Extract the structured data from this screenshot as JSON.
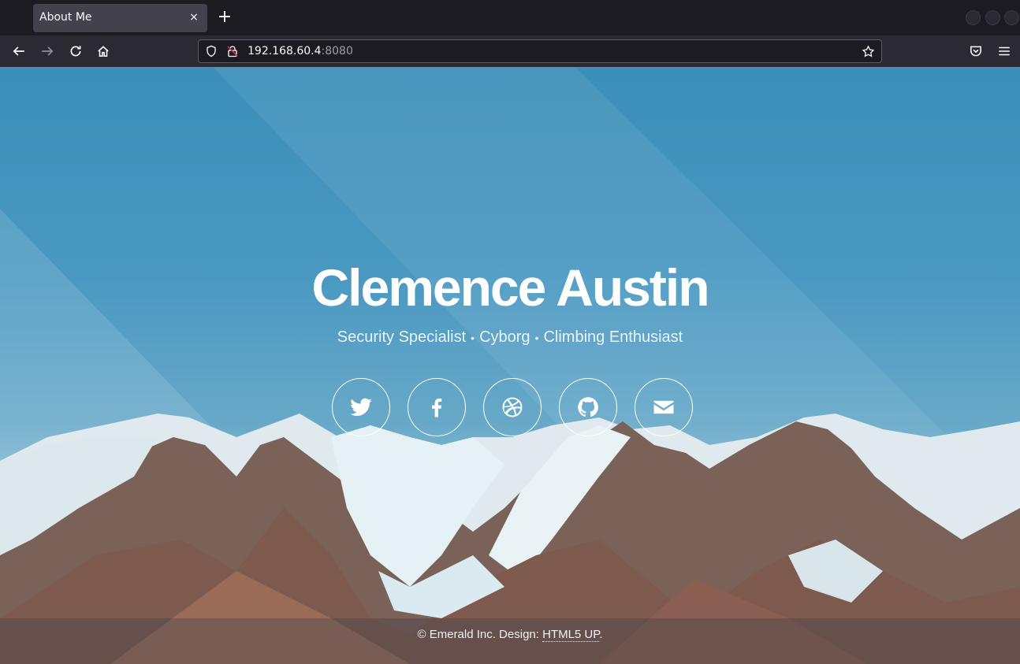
{
  "browser": {
    "tab_title": "About Me",
    "tab_close": "×",
    "new_tab": "+",
    "url_host": "192.168.60.4",
    "url_port": ":8080"
  },
  "page": {
    "name": "Clemence Austin",
    "tagline": [
      "Security Specialist",
      "Cyborg",
      "Climbing Enthusiast"
    ],
    "tagline_separator": "•",
    "socials": [
      "twitter-icon",
      "facebook-icon",
      "dribbble-icon",
      "github-icon",
      "envelope-icon"
    ],
    "footer_text": "© Emerald Inc. Design: ",
    "footer_link": "HTML5 UP",
    "footer_end": "."
  },
  "colors": {
    "sky": "#3b8fb8",
    "chrome_dark": "#1c1b22",
    "chrome_toolbar": "#2b2a33"
  }
}
